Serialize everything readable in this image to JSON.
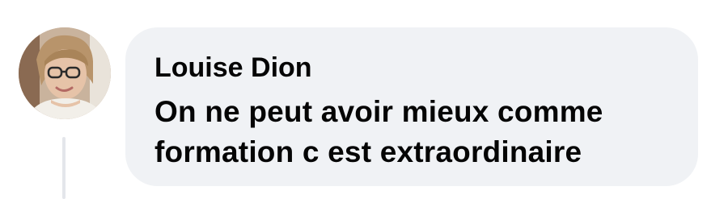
{
  "comment": {
    "author": "Louise Dion",
    "text": "On ne peut avoir mieux comme formation c est extraordinaire"
  },
  "colors": {
    "bubble_background": "#f0f2f5",
    "text": "#050505",
    "thread_line": "#e4e6eb"
  },
  "icons": {
    "avatar": "profile-photo"
  }
}
